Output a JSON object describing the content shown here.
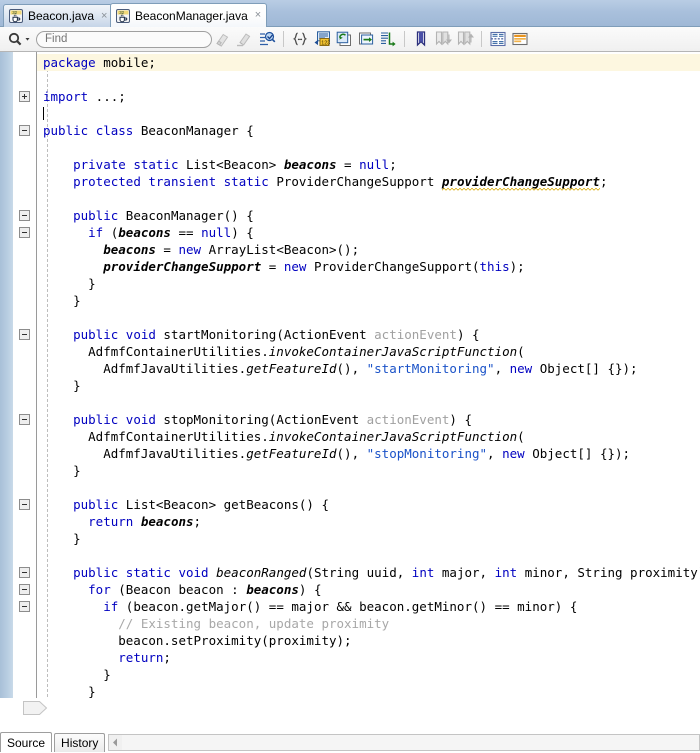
{
  "editor_tabs": [
    {
      "label": "Beacon.java",
      "icon": "java-file-icon",
      "close": "×",
      "active": false
    },
    {
      "label": "BeaconManager.java",
      "icon": "java-file-icon",
      "close": "×",
      "active": true
    }
  ],
  "toolbar": {
    "search_icon": "magnifier-icon",
    "dropdown_icon": "chevron-down-icon",
    "find_placeholder": "Find",
    "find_value": "",
    "icons": [
      {
        "name": "highlight-eraser-icon",
        "title": "Clear Highlighting"
      },
      {
        "name": "highlight-all-icon",
        "title": "Highlight All"
      },
      {
        "name": "incremental-search-icon",
        "title": "Incremental Search"
      },
      {
        "name": "brace-matching-icon",
        "title": "Block Selection"
      },
      {
        "name": "goto-line-icon",
        "title": "Go to Line"
      },
      {
        "name": "goto-last-edit-icon",
        "title": "Go to Last Edit"
      },
      {
        "name": "goto-next-icon",
        "title": "Go to Next"
      },
      {
        "name": "goto-declaration-icon",
        "title": "Go to Declaration"
      },
      {
        "name": "bookmark-icon",
        "title": "Toggle Bookmark"
      },
      {
        "name": "next-bookmark-icon",
        "title": "Go to Next Bookmark"
      },
      {
        "name": "previous-bookmark-icon",
        "title": "Go to Previous Bookmark"
      },
      {
        "name": "split-document-icon",
        "title": "Split Document"
      },
      {
        "name": "code-insight-icon",
        "title": "Code Insight"
      }
    ]
  },
  "code": {
    "language": "java",
    "current_line": 1,
    "lines": [
      {
        "fold": null,
        "current": true,
        "tokens": [
          {
            "t": "package",
            "c": "kw"
          },
          {
            "t": " mobile;",
            "c": "pl"
          }
        ]
      },
      {
        "fold": null,
        "tokens": []
      },
      {
        "fold": "plus",
        "tokens": [
          {
            "t": "import",
            "c": "kw"
          },
          {
            "t": " ...;",
            "c": "pl"
          }
        ]
      },
      {
        "fold": null,
        "tokens": []
      },
      {
        "fold": "minus",
        "tokens": [
          {
            "t": "public",
            "c": "kw"
          },
          {
            "t": " ",
            "c": "pl"
          },
          {
            "t": "class",
            "c": "kw"
          },
          {
            "t": " BeaconManager {",
            "c": "pl"
          }
        ]
      },
      {
        "fold": null,
        "tokens": []
      },
      {
        "fold": null,
        "tokens": [
          {
            "t": "    ",
            "c": "pl"
          },
          {
            "t": "private",
            "c": "kw"
          },
          {
            "t": " ",
            "c": "pl"
          },
          {
            "t": "static",
            "c": "kw"
          },
          {
            "t": " List<Beacon> ",
            "c": "pl"
          },
          {
            "t": "beacons",
            "c": "fld"
          },
          {
            "t": " = ",
            "c": "pl"
          },
          {
            "t": "null",
            "c": "kw"
          },
          {
            "t": ";",
            "c": "pl"
          }
        ]
      },
      {
        "fold": null,
        "tokens": [
          {
            "t": "    ",
            "c": "pl"
          },
          {
            "t": "protected",
            "c": "kw"
          },
          {
            "t": " ",
            "c": "pl"
          },
          {
            "t": "transient",
            "c": "kw"
          },
          {
            "t": " ",
            "c": "pl"
          },
          {
            "t": "static",
            "c": "kw"
          },
          {
            "t": " ProviderChangeSupport ",
            "c": "pl"
          },
          {
            "t": "providerChangeSupport",
            "c": "fld squig"
          },
          {
            "t": ";",
            "c": "pl"
          }
        ]
      },
      {
        "fold": null,
        "tokens": []
      },
      {
        "fold": "minus",
        "tokens": [
          {
            "t": "    ",
            "c": "pl"
          },
          {
            "t": "public",
            "c": "kw"
          },
          {
            "t": " BeaconManager() {",
            "c": "pl"
          }
        ]
      },
      {
        "fold": "minus",
        "tokens": [
          {
            "t": "      ",
            "c": "pl"
          },
          {
            "t": "if",
            "c": "kw"
          },
          {
            "t": " (",
            "c": "pl"
          },
          {
            "t": "beacons",
            "c": "fld"
          },
          {
            "t": " == ",
            "c": "pl"
          },
          {
            "t": "null",
            "c": "kw"
          },
          {
            "t": ") {",
            "c": "pl"
          }
        ]
      },
      {
        "fold": null,
        "tokens": [
          {
            "t": "        ",
            "c": "pl"
          },
          {
            "t": "beacons",
            "c": "fld"
          },
          {
            "t": " = ",
            "c": "pl"
          },
          {
            "t": "new",
            "c": "kw"
          },
          {
            "t": " ArrayList<Beacon>();",
            "c": "pl"
          }
        ]
      },
      {
        "fold": null,
        "tokens": [
          {
            "t": "        ",
            "c": "pl"
          },
          {
            "t": "providerChangeSupport",
            "c": "fld"
          },
          {
            "t": " = ",
            "c": "pl"
          },
          {
            "t": "new",
            "c": "kw"
          },
          {
            "t": " ProviderChangeSupport(",
            "c": "pl"
          },
          {
            "t": "this",
            "c": "kw"
          },
          {
            "t": ");",
            "c": "pl"
          }
        ]
      },
      {
        "fold": null,
        "tokens": [
          {
            "t": "      }",
            "c": "pl"
          }
        ]
      },
      {
        "fold": null,
        "tokens": [
          {
            "t": "    }",
            "c": "pl"
          }
        ]
      },
      {
        "fold": null,
        "tokens": []
      },
      {
        "fold": "minus",
        "tokens": [
          {
            "t": "    ",
            "c": "pl"
          },
          {
            "t": "public",
            "c": "kw"
          },
          {
            "t": " ",
            "c": "pl"
          },
          {
            "t": "void",
            "c": "kw"
          },
          {
            "t": " startMonitoring(ActionEvent ",
            "c": "pl"
          },
          {
            "t": "actionEvent",
            "c": "unused"
          },
          {
            "t": ") {",
            "c": "pl"
          }
        ]
      },
      {
        "fold": null,
        "tokens": [
          {
            "t": "      AdfmfContainerUtilities.",
            "c": "pl"
          },
          {
            "t": "invokeContainerJavaScriptFunction",
            "c": "stm"
          },
          {
            "t": "(",
            "c": "pl"
          }
        ]
      },
      {
        "fold": null,
        "tokens": [
          {
            "t": "        AdfmfJavaUtilities.",
            "c": "pl"
          },
          {
            "t": "getFeatureId",
            "c": "stm"
          },
          {
            "t": "(), ",
            "c": "pl"
          },
          {
            "t": "\"startMonitoring\"",
            "c": "str"
          },
          {
            "t": ", ",
            "c": "pl"
          },
          {
            "t": "new",
            "c": "kw"
          },
          {
            "t": " Object[] {});",
            "c": "pl"
          }
        ]
      },
      {
        "fold": null,
        "tokens": [
          {
            "t": "    }",
            "c": "pl"
          }
        ]
      },
      {
        "fold": null,
        "tokens": []
      },
      {
        "fold": "minus",
        "tokens": [
          {
            "t": "    ",
            "c": "pl"
          },
          {
            "t": "public",
            "c": "kw"
          },
          {
            "t": " ",
            "c": "pl"
          },
          {
            "t": "void",
            "c": "kw"
          },
          {
            "t": " stopMonitoring(ActionEvent ",
            "c": "pl"
          },
          {
            "t": "actionEvent",
            "c": "unused"
          },
          {
            "t": ") {",
            "c": "pl"
          }
        ]
      },
      {
        "fold": null,
        "tokens": [
          {
            "t": "      AdfmfContainerUtilities.",
            "c": "pl"
          },
          {
            "t": "invokeContainerJavaScriptFunction",
            "c": "stm"
          },
          {
            "t": "(",
            "c": "pl"
          }
        ]
      },
      {
        "fold": null,
        "tokens": [
          {
            "t": "        AdfmfJavaUtilities.",
            "c": "pl"
          },
          {
            "t": "getFeatureId",
            "c": "stm"
          },
          {
            "t": "(), ",
            "c": "pl"
          },
          {
            "t": "\"stopMonitoring\"",
            "c": "str"
          },
          {
            "t": ", ",
            "c": "pl"
          },
          {
            "t": "new",
            "c": "kw"
          },
          {
            "t": " Object[] {});",
            "c": "pl"
          }
        ]
      },
      {
        "fold": null,
        "tokens": [
          {
            "t": "    }",
            "c": "pl"
          }
        ]
      },
      {
        "fold": null,
        "tokens": []
      },
      {
        "fold": "minus",
        "tokens": [
          {
            "t": "    ",
            "c": "pl"
          },
          {
            "t": "public",
            "c": "kw"
          },
          {
            "t": " List<Beacon> getBeacons() {",
            "c": "pl"
          }
        ]
      },
      {
        "fold": null,
        "tokens": [
          {
            "t": "      ",
            "c": "pl"
          },
          {
            "t": "return",
            "c": "kw"
          },
          {
            "t": " ",
            "c": "pl"
          },
          {
            "t": "beacons",
            "c": "fld"
          },
          {
            "t": ";",
            "c": "pl"
          }
        ]
      },
      {
        "fold": null,
        "tokens": [
          {
            "t": "    }",
            "c": "pl"
          }
        ]
      },
      {
        "fold": null,
        "tokens": []
      },
      {
        "fold": "minus",
        "tokens": [
          {
            "t": "    ",
            "c": "pl"
          },
          {
            "t": "public",
            "c": "kw"
          },
          {
            "t": " ",
            "c": "pl"
          },
          {
            "t": "static",
            "c": "kw"
          },
          {
            "t": " ",
            "c": "pl"
          },
          {
            "t": "void",
            "c": "kw"
          },
          {
            "t": " ",
            "c": "pl"
          },
          {
            "t": "beaconRanged",
            "c": "stm"
          },
          {
            "t": "(String uuid, ",
            "c": "pl"
          },
          {
            "t": "int",
            "c": "kw"
          },
          {
            "t": " major, ",
            "c": "pl"
          },
          {
            "t": "int",
            "c": "kw"
          },
          {
            "t": " minor, String proximity) {",
            "c": "pl"
          }
        ]
      },
      {
        "fold": "minus",
        "tokens": [
          {
            "t": "      ",
            "c": "pl"
          },
          {
            "t": "for",
            "c": "kw"
          },
          {
            "t": " (Beacon beacon : ",
            "c": "pl"
          },
          {
            "t": "beacons",
            "c": "fld"
          },
          {
            "t": ") {",
            "c": "pl"
          }
        ]
      },
      {
        "fold": "minus",
        "tokens": [
          {
            "t": "        ",
            "c": "pl"
          },
          {
            "t": "if",
            "c": "kw"
          },
          {
            "t": " (beacon.getMajor() == major && beacon.getMinor() == minor) {",
            "c": "pl"
          }
        ]
      },
      {
        "fold": null,
        "tokens": [
          {
            "t": "          ",
            "c": "pl"
          },
          {
            "t": "// Existing beacon, update proximity",
            "c": "cmt"
          }
        ]
      },
      {
        "fold": null,
        "tokens": [
          {
            "t": "          beacon.setProximity(proximity);",
            "c": "pl"
          }
        ]
      },
      {
        "fold": null,
        "tokens": [
          {
            "t": "          ",
            "c": "pl"
          },
          {
            "t": "return",
            "c": "kw"
          },
          {
            "t": ";",
            "c": "pl"
          }
        ]
      },
      {
        "fold": null,
        "tokens": [
          {
            "t": "        }",
            "c": "pl"
          }
        ]
      },
      {
        "fold": null,
        "tokens": [
          {
            "t": "      }",
            "c": "pl"
          }
        ]
      }
    ]
  },
  "bottom": {
    "tabs": [
      {
        "label": "Source",
        "selected": true
      },
      {
        "label": "History",
        "selected": false
      }
    ],
    "scroll_left_icon": "scroll-left-arrow-icon"
  },
  "colors": {
    "keyword": "#0000c0",
    "string": "#1a52c8",
    "comment": "#a8a8a8",
    "current_line_highlight": "#fdf7e0",
    "tabbar_background": "#a9c0dc",
    "left_strip": "#b9cee2"
  }
}
